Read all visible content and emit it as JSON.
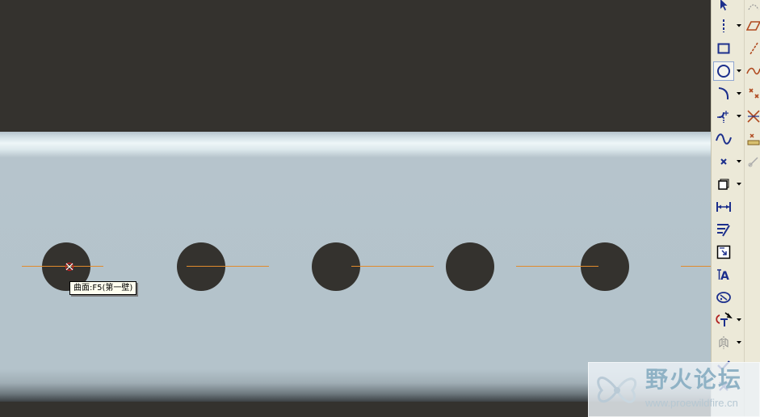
{
  "viewport": {
    "tooltip_text": "曲面:F5(第一壁)",
    "hole_count": 5
  },
  "toolbar": {
    "buttons": [
      {
        "name": "select-icon",
        "has_menu": false
      },
      {
        "name": "centerline-icon",
        "has_menu": true
      },
      {
        "name": "rectangle-icon",
        "has_menu": false
      },
      {
        "name": "circle-icon",
        "has_menu": true,
        "active": true
      },
      {
        "name": "arc-icon",
        "has_menu": true
      },
      {
        "name": "fillet-icon",
        "has_menu": true
      },
      {
        "name": "spline-icon",
        "has_menu": false
      },
      {
        "name": "point-icon",
        "has_menu": true
      },
      {
        "name": "use-edge-icon",
        "has_menu": true
      },
      {
        "name": "dimension-icon",
        "has_menu": false
      },
      {
        "name": "modify-icon",
        "has_menu": false
      },
      {
        "name": "constraints-icon",
        "has_menu": false
      },
      {
        "name": "text-icon",
        "has_menu": false
      },
      {
        "name": "palette-icon",
        "has_menu": false
      },
      {
        "name": "trim-icon",
        "has_menu": true
      },
      {
        "name": "mirror-icon",
        "has_menu": true
      },
      {
        "name": "done-checkmark-icon",
        "has_menu": false
      },
      {
        "name": "quit-x-icon",
        "has_menu": false
      }
    ],
    "text_icon_label": "A"
  },
  "watermark": {
    "title": "野火论坛",
    "url": "www.proewildfire.cn"
  },
  "colors": {
    "background": "#34322e",
    "part_surface": "#b4c3cb",
    "centerline": "#e08a2c",
    "toolbar_bg": "#ece9d8",
    "icon_blue": "#1c2f8c"
  }
}
